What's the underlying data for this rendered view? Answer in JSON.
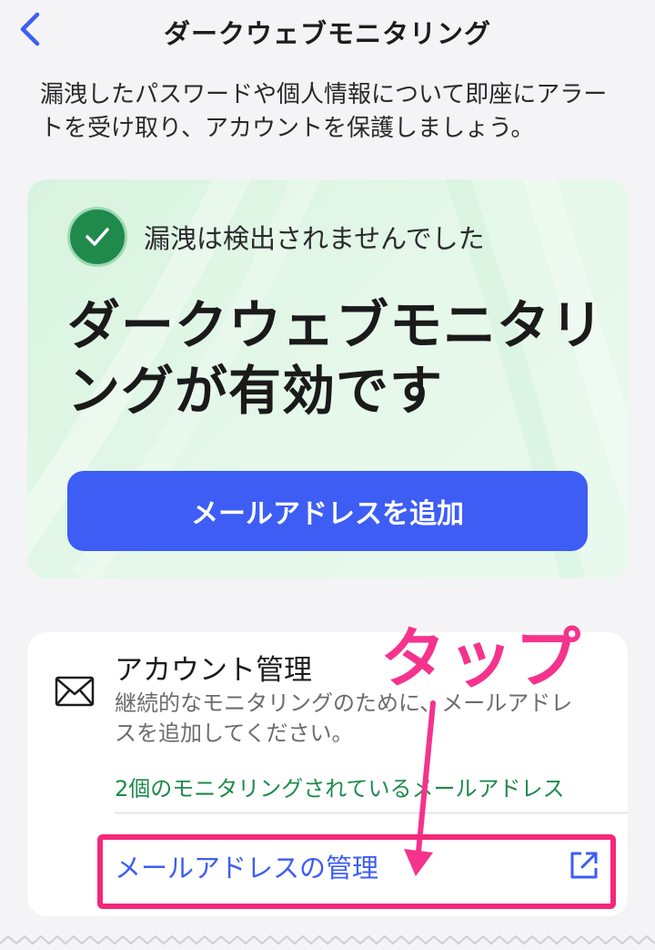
{
  "nav": {
    "title": "ダークウェブモニタリング",
    "back_icon": "chevron-left-icon"
  },
  "intro": {
    "text": "漏洩したパスワードや個人情報について即座にアラートを受け取り、アカウントを保護しましょう。"
  },
  "hero": {
    "status_icon": "check-circle-icon",
    "status_text": "漏洩は検出されませんでした",
    "title": "ダークウェブモニタリングが有効です",
    "button_label": "メールアドレスを追加"
  },
  "account": {
    "icon": "envelope-icon",
    "title": "アカウント管理",
    "description": "継続的なモニタリングのために、メールアドレスを追加してください。",
    "count_text": "2個のモニタリングされているメールアドレス",
    "manage_link": "メールアドレスの管理",
    "link_icon": "external-link-icon"
  },
  "annotation": {
    "tap_label": "タップ"
  },
  "colors": {
    "accent_blue": "#3d5df5",
    "success_green": "#1f8a4c",
    "annotation_pink": "#f4287a",
    "hero_background": "#e2f6e7"
  }
}
